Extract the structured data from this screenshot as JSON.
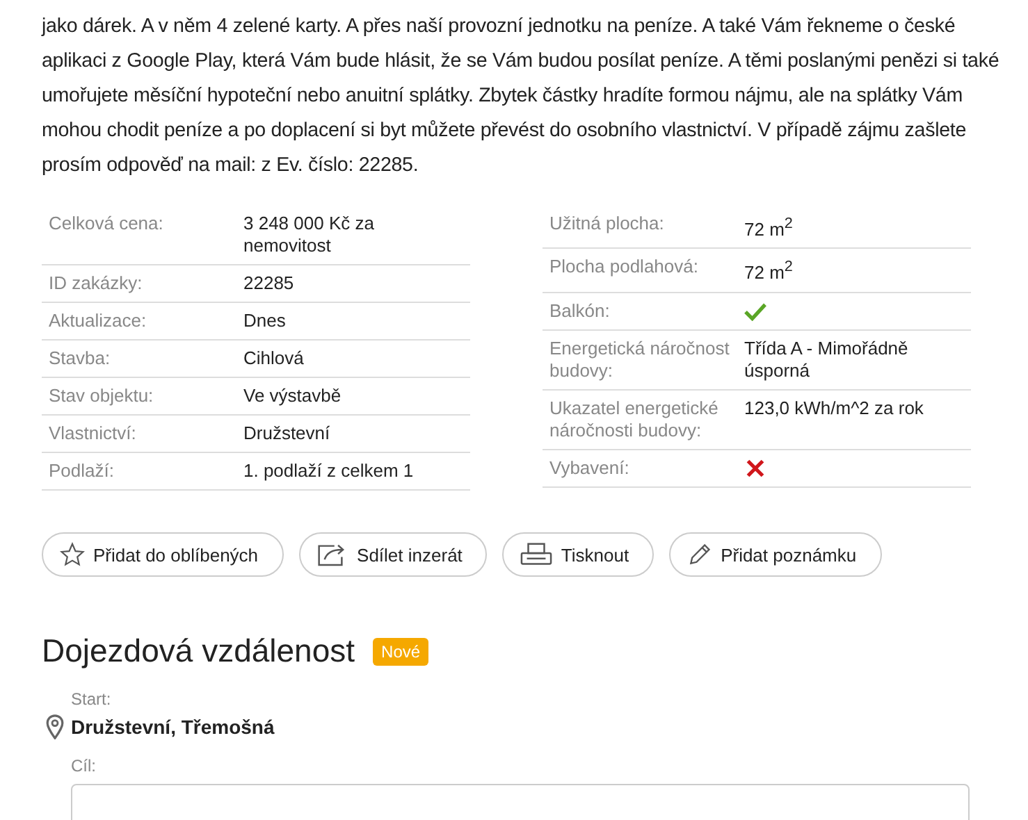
{
  "description": "jako dárek. A v něm 4 zelené karty. A přes naší provozní jednotku na peníze. A také Vám řekneme o české aplikaci z Google Play, která Vám bude hlásit, že se Vám budou posílat peníze. A těmi poslanými penězi si také umořujete měsíční hypoteční nebo anuitní splátky. Zbytek částky hradíte formou nájmu, ale na splátky Vám mohou chodit peníze a po doplacení si byt můžete převést do osobního vlastnictví. V případě zájmu zašlete prosím odpověď na mail: z Ev. číslo: 22285.",
  "params_left": [
    {
      "label": "Celková cena:",
      "kind": "text",
      "value": "3 248 000 Kč za nemovitost"
    },
    {
      "label": "ID zakázky:",
      "kind": "text",
      "value": "22285"
    },
    {
      "label": "Aktualizace:",
      "kind": "text",
      "value": "Dnes"
    },
    {
      "label": "Stavba:",
      "kind": "text",
      "value": "Cihlová"
    },
    {
      "label": "Stav objektu:",
      "kind": "text",
      "value": "Ve výstavbě"
    },
    {
      "label": "Vlastnictví:",
      "kind": "text",
      "value": "Družstevní"
    },
    {
      "label": "Podlaží:",
      "kind": "text",
      "value": "1. podlaží z celkem 1"
    }
  ],
  "params_right": [
    {
      "label": "Užitná plocha:",
      "kind": "text",
      "value": "72 m$^{2}$"
    },
    {
      "label": "Plocha podlahová:",
      "kind": "text",
      "value": "72 m$^{2}$"
    },
    {
      "label": "Balkón:",
      "kind": "flag",
      "on": true
    },
    {
      "label": "Energetická náročnost budovy:",
      "kind": "text",
      "value": "Třída A - Mimořádně úsporná"
    },
    {
      "label": "Ukazatel energetické náročnosti budovy:",
      "kind": "text",
      "value": "123,0 kWh/m^2 za rok"
    },
    {
      "label": "Vybavení:",
      "kind": "flag",
      "on": false
    }
  ],
  "actions": [
    {
      "label": "Přidat do oblíbených",
      "kind": "favorite"
    },
    {
      "label": "Sdílet inzerát",
      "kind": "share"
    },
    {
      "label": "Tisknout",
      "kind": "print"
    },
    {
      "label": "Přidat poznámku",
      "kind": "note"
    }
  ],
  "commute": {
    "title": "Dojezdová vzdálenost",
    "badge": "Nové",
    "start_label": "Start:",
    "start": "Družstevní, Třemošná",
    "destination_label": "Cíl:"
  }
}
